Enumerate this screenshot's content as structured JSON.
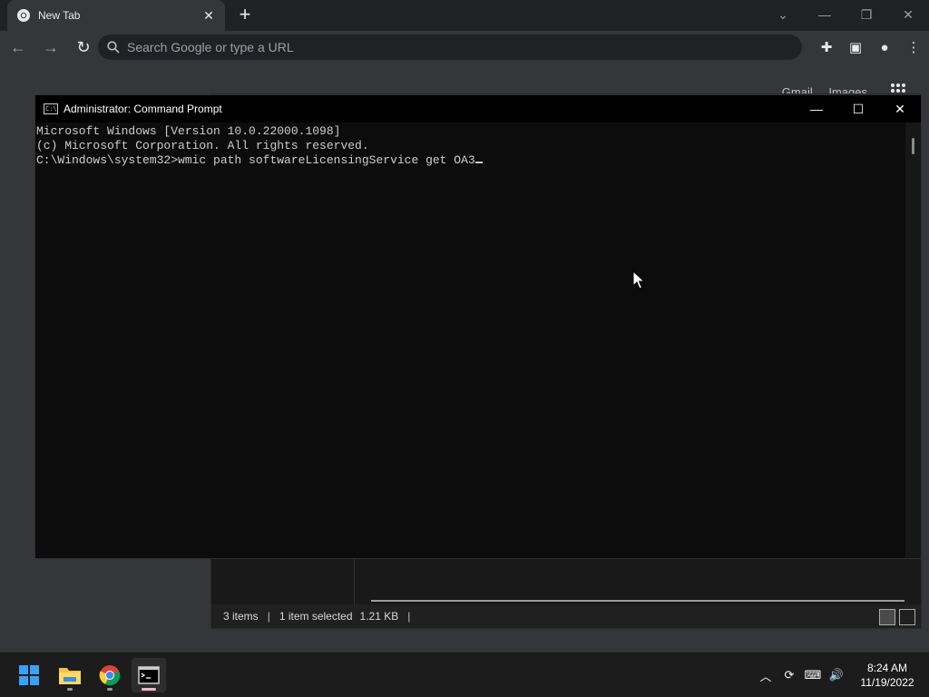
{
  "browser": {
    "tab_title": "New Tab",
    "tab_close": "✕",
    "new_tab": "+",
    "omnibox_placeholder": "Search Google or type a URL",
    "page_links": [
      "Gmail",
      "Images"
    ]
  },
  "explorer": {
    "status": {
      "items": "3 items",
      "selected": "1 item selected",
      "size": "1.21 KB"
    }
  },
  "cmd": {
    "title": "Administrator: Command Prompt",
    "lines": [
      "Microsoft Windows [Version 10.0.22000.1098]",
      "(c) Microsoft Corporation. All rights reserved.",
      "C:\\Windows\\system32>wmic path softwareLicensingService get OA3"
    ]
  },
  "taskbar": {
    "time": "8:24 AM",
    "date": "11/19/2022"
  },
  "colors": {
    "accent_blue": "#3aa0f3",
    "cmd_text": "#cccccc",
    "chrome_toolbar": "#35363a"
  }
}
